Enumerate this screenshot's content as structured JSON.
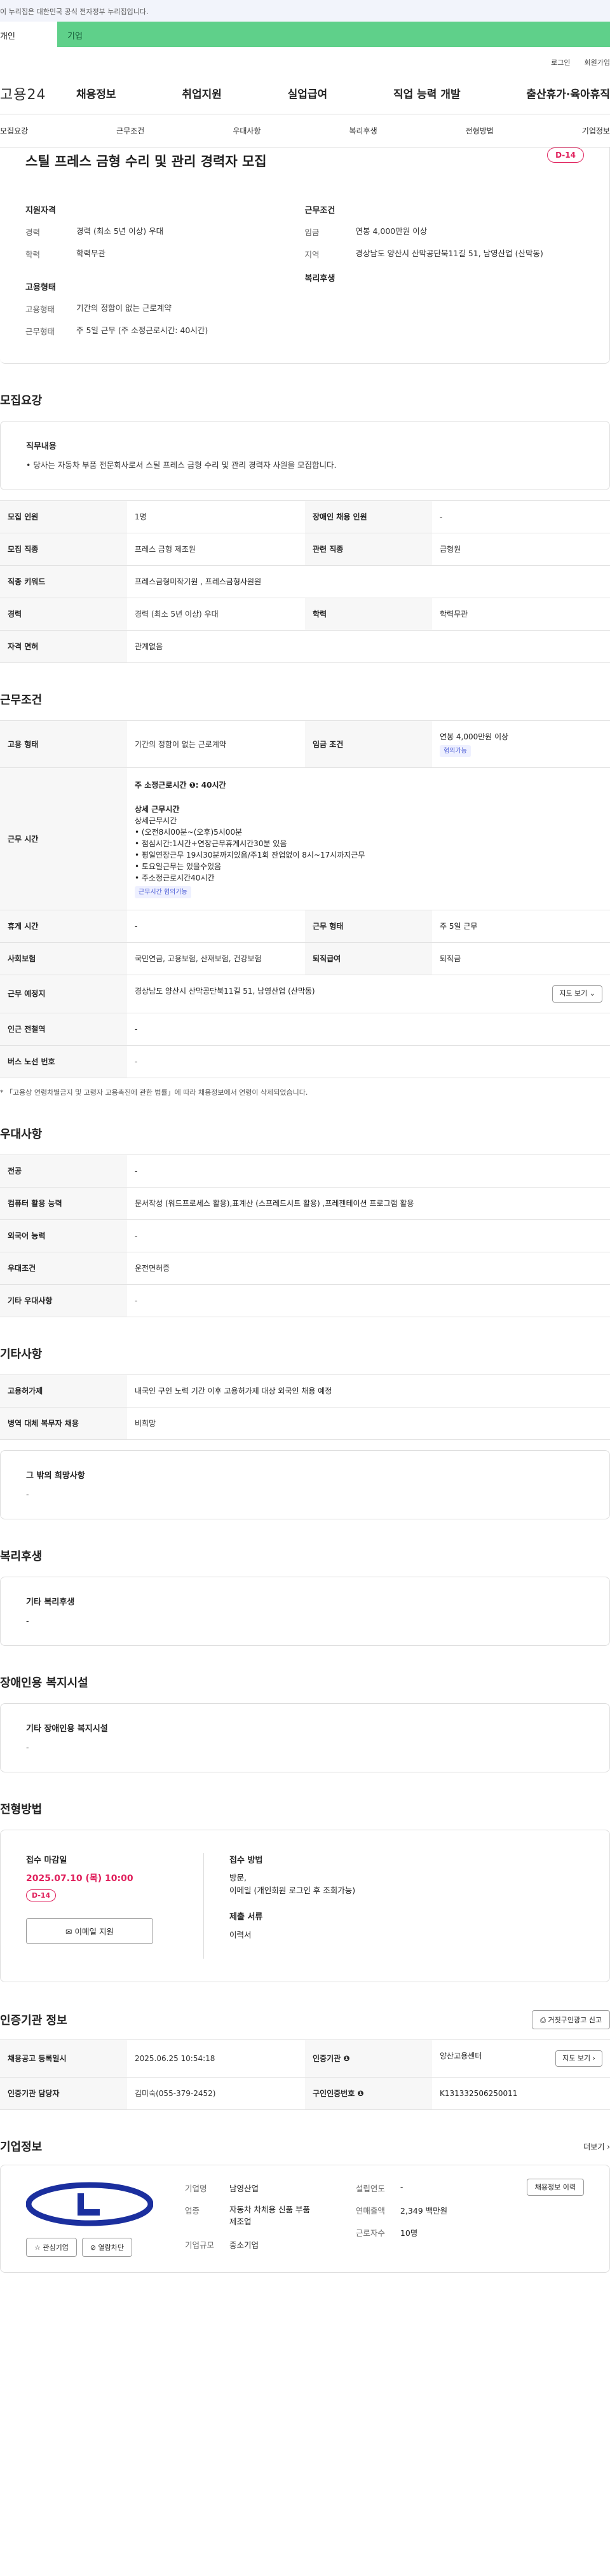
{
  "gov_banner": "이 누리집은 대한민국 공식 전자정부 누리집입니다.",
  "tabs": {
    "personal": "개인",
    "company": "기업"
  },
  "util": {
    "login": "로그인",
    "join": "회원가입"
  },
  "logo": "고용24",
  "nav": [
    "채용정보",
    "취업지원",
    "실업급여",
    "직업 능력 개발",
    "출산휴가·육아휴직"
  ],
  "subnav": [
    "모집요강",
    "근무조건",
    "우대사항",
    "복리후생",
    "전형방법",
    "기업정보"
  ],
  "summary": {
    "title": "스틸 프레스 금형 수리 및 관리 경력자 모집",
    "dday": "D-14",
    "qual_h": "지원자격",
    "career_k": "경력",
    "career_v": "경력 (최소 5년 이상) 우대",
    "edu_k": "학력",
    "edu_v": "학력무관",
    "cond_h": "근무조건",
    "wage_k": "임금",
    "wage_v": "연봉 4,000만원 이상",
    "region_k": "지역",
    "region_v": "경상남도 양산시 산막공단북11길 51, 남영산업 (산막동)",
    "emp_h": "고용형태",
    "emp_k": "고용형태",
    "emp_v": "기간의 정함이 없는 근로계약",
    "work_k": "근무형태",
    "work_v": "주 5일 근무 (주 소정근로시간: 40시간)",
    "welfare_h": "복리후생"
  },
  "recruit": {
    "title": "모집요강",
    "duty_h": "직무내용",
    "duty_t": "• 당사는 자동차 부품 전문회사로서 스틸 프레스 금형 수리 및 관리 경력자 사원을 모집합니다.",
    "rows": [
      [
        "모집 인원",
        "1명",
        "장애인 채용 인원",
        "-"
      ],
      [
        "모집 직종",
        "프레스 금형 제조원",
        "관련 직종",
        "금형원"
      ],
      [
        "직종 키워드",
        "프레스금형미작기원 , 프레스금형사원원",
        "",
        ""
      ],
      [
        "경력",
        "경력 (최소 5년 이상) 우대",
        "학력",
        "학력무관"
      ],
      [
        "자격 면허",
        "관계없음",
        "",
        ""
      ]
    ]
  },
  "workcond": {
    "title": "근무조건",
    "emp_k": "고용 형태",
    "emp_v": "기간의 정함이 없는 근로계약",
    "wage_k": "임금 조건",
    "wage_v": "연봉 4,000만원 이상",
    "wage_chip": "협의가능",
    "hours_k": "근무 시간",
    "hours_main": "주 소정근로시간 ❶: 40시간",
    "hours_sub_h": "상세 근무시간",
    "hours_lines": [
      "상세근무시간",
      "• (오전8시00분~(오후)5시00분",
      "• 점심시간:1시간+연장근무휴게시간30분 있음",
      "• 평일연장근무 19시30분까지있음/주1회 잔업없이 8시~17시까지근무",
      "• 토요일근무는 있을수있음",
      "• 주소정근로시간40시간"
    ],
    "hours_chip": "근무시간 협의가능",
    "rows": [
      [
        "휴게 시간",
        "-",
        "근무 형태",
        "주 5일 근무"
      ],
      [
        "사회보험",
        "국민연금, 고용보험, 산재보험, 건강보험",
        "퇴직급여",
        "퇴직금"
      ]
    ],
    "place_k": "근무 예정지",
    "place_v": "경상남도 양산시 산막공단북11길 51, 남영산업 (산막동)",
    "map_btn": "지도 보기 ⌄",
    "subway_k": "인근 전철역",
    "subway_v": "-",
    "bus_k": "버스 노선 번호",
    "bus_v": "-",
    "note": "* 「고용상 연령차별금지 및 고령자 고용촉진에 관한 법률」에 따라 채용정보에서 연령이 삭제되었습니다."
  },
  "pref": {
    "title": "우대사항",
    "rows": [
      [
        "전공",
        "-"
      ],
      [
        "컴퓨터 활용 능력",
        "문서작성 (워드프로세스 활용),표계산 (스프레드시트 활용) ,프레젠테이션 프로그램 활용"
      ],
      [
        "외국어 능력",
        "-"
      ],
      [
        "우대조건",
        "운전면허증"
      ],
      [
        "기타 우대사항",
        "-"
      ]
    ]
  },
  "other": {
    "title": "기타사항",
    "rows": [
      [
        "고용허가제",
        "내국인 구인 노력 기간 이후 고용허가제 대상 외국인 채용 예정"
      ],
      [
        "병역 대체 복무자 채용",
        "비희망"
      ]
    ],
    "wish_h": "그 밖의 희망사항",
    "wish_v": "-"
  },
  "welfare": {
    "title": "복리후생",
    "h": "기타 복리후생",
    "v": "-"
  },
  "disab": {
    "title": "장애인용 복지시설",
    "h": "기타 장애인용 복지시설",
    "v": "-"
  },
  "apply": {
    "title": "전형방법",
    "deadline_h": "접수 마감일",
    "deadline": "2025.07.10 (목) 10:00",
    "dday": "D-14",
    "email_btn": "✉ 이메일 지원",
    "method_h": "접수 방법",
    "method_v": "방문,\n이메일 (개인회원 로그인 후 조회가능)",
    "docs_h": "제출 서류",
    "docs_v": "이력서"
  },
  "cert": {
    "title": "인증기관 정보",
    "btn": "⎙ 거짓구인광고 신고",
    "rows": [
      [
        "채용공고 등록일시",
        "2025.06.25 10:54:18",
        "인증기관 ❶",
        "양산고용센터"
      ],
      [
        "인증기관 담당자",
        "김미숙(055-379-2452)",
        "구인인증번호 ❶",
        "K131332506250011"
      ]
    ],
    "map_btn": "지도 보기 ›"
  },
  "company": {
    "title": "기업정보",
    "more": "더보기 ›",
    "fav": "☆ 관심기업",
    "block": "⊘ 열람차단",
    "name_k": "기업명",
    "name_v": "남영산업",
    "ind_k": "업종",
    "ind_v": "자동차 차체용 신품 부품 제조업",
    "size_k": "기업규모",
    "size_v": "중소기업",
    "est_k": "설립연도",
    "est_v": "-",
    "sales_k": "연매출액",
    "sales_v": "2,349 백만원",
    "emp_k": "근로자수",
    "emp_v": "10명",
    "jobs_btn": "채용정보 이력"
  },
  "colors": {
    "accent": "#5fd08a",
    "dday": "#e0205c",
    "logo_blue": "#1b2f9e"
  }
}
